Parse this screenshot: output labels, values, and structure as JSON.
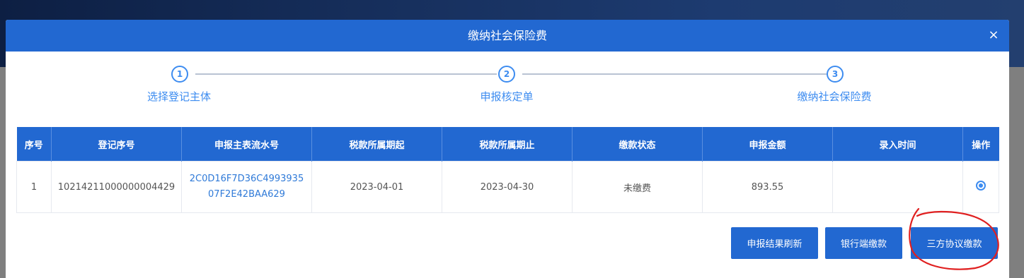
{
  "modal": {
    "title": "缴纳社会保险费",
    "close_glyph": "×"
  },
  "steps": [
    {
      "number": "1",
      "label": "选择登记主体"
    },
    {
      "number": "2",
      "label": "申报核定单"
    },
    {
      "number": "3",
      "label": "缴纳社会保险费"
    }
  ],
  "table": {
    "headers": [
      "序号",
      "登记序号",
      "申报主表流水号",
      "税款所属期起",
      "税款所属期止",
      "缴款状态",
      "申报金额",
      "录入时间",
      "操作"
    ],
    "rows": [
      {
        "index": "1",
        "reg_no": "10214211000000004429",
        "serial_line1": "2C0D16F7D36C4993935",
        "serial_line2": "07F2E42BAA629",
        "period_start": "2023-04-01",
        "period_end": "2023-04-30",
        "status": "未缴费",
        "amount": "893.55",
        "entry_time": ""
      }
    ]
  },
  "buttons": {
    "refresh": "申报结果刷新",
    "bank": "银行端缴款",
    "tripartite": "三方协议缴款"
  },
  "colors": {
    "primary": "#2268d1",
    "accent": "#3d8cf0",
    "annotation": "#e02020"
  },
  "icons": {
    "close": "close-icon",
    "radio": "radio-selected-icon"
  }
}
